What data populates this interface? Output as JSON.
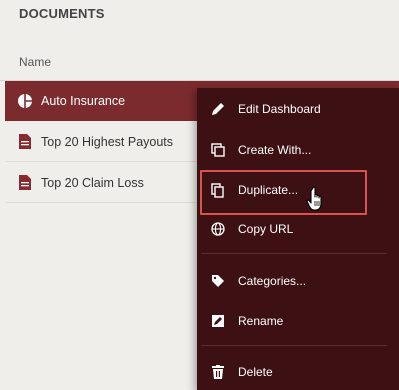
{
  "header": {
    "title": "DOCUMENTS",
    "column_name": "Name"
  },
  "documents": [
    {
      "label": "Auto Insurance",
      "icon": "pie-chart-icon"
    },
    {
      "label": "Top 20 Highest Payouts",
      "icon": "document-icon"
    },
    {
      "label": "Top 20 Claim Loss",
      "icon": "document-icon"
    }
  ],
  "context_menu": {
    "items": [
      {
        "label": "Edit Dashboard",
        "icon": "pencil-icon"
      },
      {
        "label": "Create With...",
        "icon": "create-with-icon"
      },
      {
        "label": "Duplicate...",
        "icon": "duplicate-icon"
      },
      {
        "label": "Copy URL",
        "icon": "globe-icon"
      },
      {
        "label": "Categories...",
        "icon": "tag-icon"
      },
      {
        "label": "Rename",
        "icon": "rename-icon"
      },
      {
        "label": "Delete",
        "icon": "trash-icon"
      }
    ]
  },
  "colors": {
    "selected_row": "#7b2a2e",
    "menu_background": "#3d1013",
    "highlight_border": "#d9534f",
    "doc_icon": "#8b2a2e"
  }
}
